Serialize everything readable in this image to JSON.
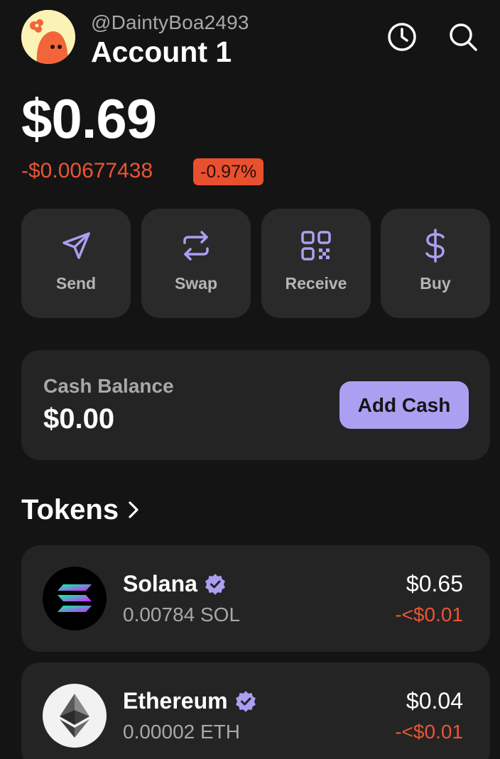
{
  "header": {
    "handle": "@DaintyBoa2493",
    "account_name": "Account 1",
    "icons": [
      "history-icon",
      "search-icon"
    ]
  },
  "balance": {
    "total": "$0.69",
    "change_usd": "-$0.00677438",
    "change_pct": "-0.97%"
  },
  "actions": [
    {
      "label": "Send",
      "icon": "send-icon"
    },
    {
      "label": "Swap",
      "icon": "swap-icon"
    },
    {
      "label": "Receive",
      "icon": "qr-code-icon"
    },
    {
      "label": "Buy",
      "icon": "dollar-icon"
    }
  ],
  "cash": {
    "label": "Cash Balance",
    "value": "$0.00",
    "button_label": "Add Cash"
  },
  "tokens": {
    "title": "Tokens",
    "items": [
      {
        "name": "Solana",
        "amount": "0.00784 SOL",
        "usd": "$0.65",
        "delta": "-<$0.01",
        "icon": "solana-logo-icon",
        "verified": true
      },
      {
        "name": "Ethereum",
        "amount": "0.00002 ETH",
        "usd": "$0.04",
        "delta": "-<$0.01",
        "icon": "ethereum-logo-icon",
        "verified": true
      }
    ]
  },
  "colors": {
    "background": "#141414",
    "card": "#242424",
    "accent": "#ab9ff2",
    "negative": "#eb5534"
  }
}
